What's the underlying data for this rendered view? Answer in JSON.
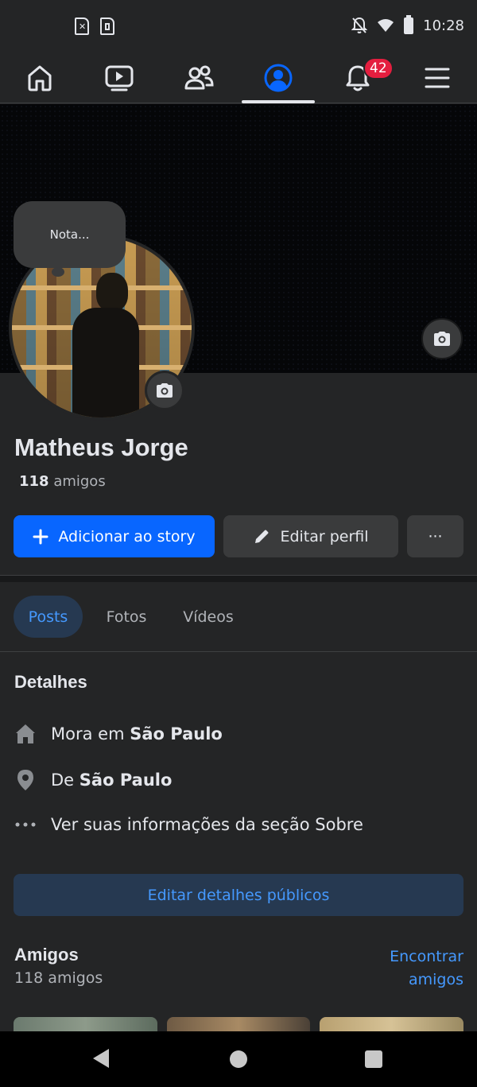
{
  "status_bar": {
    "time": "10:28",
    "left_icons": [
      "sim-x-icon",
      "sim-icon"
    ],
    "right_icons": [
      "notifications-muted-icon",
      "wifi-icon",
      "battery-icon"
    ]
  },
  "nav": {
    "items": [
      {
        "name": "home",
        "icon": "home-icon"
      },
      {
        "name": "watch",
        "icon": "video-icon"
      },
      {
        "name": "friends",
        "icon": "friends-icon"
      },
      {
        "name": "profile",
        "icon": "profile-icon",
        "active": true
      },
      {
        "name": "notifications",
        "icon": "bell-icon",
        "badge": "42"
      },
      {
        "name": "menu",
        "icon": "menu-icon"
      }
    ]
  },
  "note": {
    "text": "Nota..."
  },
  "profile": {
    "name": "Matheus Jorge",
    "friends_count": "118",
    "friends_label": "amigos"
  },
  "actions": {
    "add_story": "Adicionar ao story",
    "edit_profile": "Editar perfil",
    "more": "···"
  },
  "tabs": [
    {
      "label": "Posts",
      "active": true
    },
    {
      "label": "Fotos"
    },
    {
      "label": "Vídeos"
    }
  ],
  "details": {
    "title": "Detalhes",
    "lives_prefix": "Mora em",
    "lives_city": "São Paulo",
    "from_prefix": "De",
    "from_city": "São Paulo",
    "about_link": "Ver suas informações da seção Sobre",
    "edit_button": "Editar detalhes públicos"
  },
  "friends_section": {
    "title": "Amigos",
    "subtitle": "118 amigos",
    "find_link": "Encontrar amigos"
  },
  "colors": {
    "background": "#242526",
    "primary": "#0866ff",
    "link": "#4599ff",
    "badge": "#e41e3f"
  }
}
